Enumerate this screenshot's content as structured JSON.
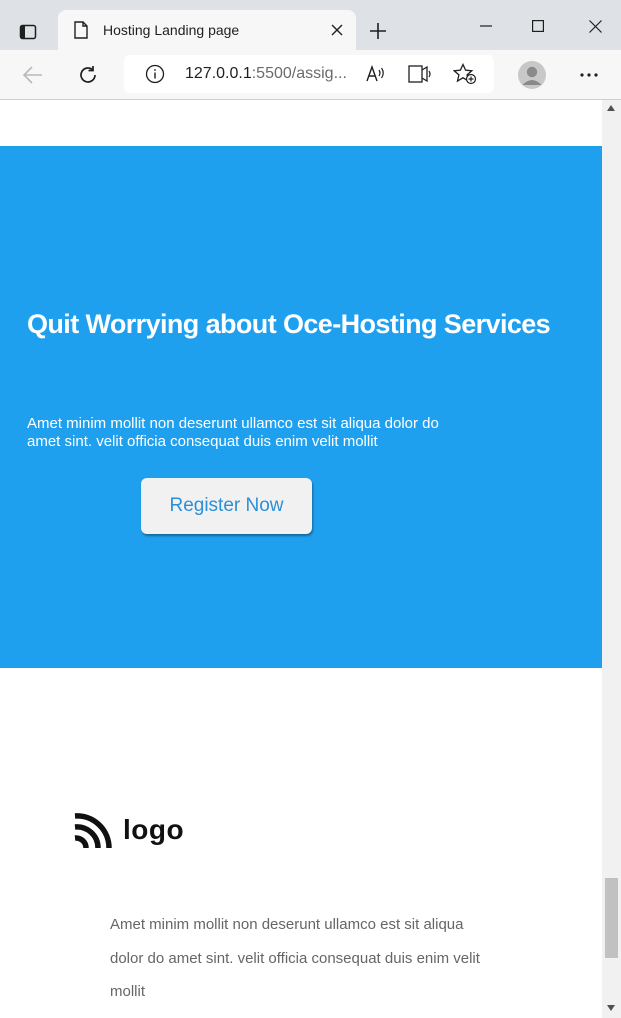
{
  "browser": {
    "tab_title": "Hosting Landing page",
    "url_host": "127.0.0.1",
    "url_rest": ":5500/assig..."
  },
  "icons": {
    "tab_actions": "tab-actions-icon",
    "page": "page-icon",
    "close": "close-icon",
    "new_tab": "plus-icon",
    "minimize": "minimize-icon",
    "maximize": "maximize-icon",
    "window_close": "close-icon",
    "back": "back-arrow-icon",
    "refresh": "refresh-icon",
    "site_info": "info-icon",
    "read_aloud": "read-aloud-icon",
    "immersive_reader": "immersive-reader-icon",
    "favorites": "favorites-star-icon",
    "profile": "profile-avatar-icon",
    "more": "more-dots-icon"
  },
  "hero": {
    "title": "Quit Worrying about Oce-Hosting Services",
    "text": "Amet minim mollit non deserunt ullamco est sit aliqua dolor do amet sint. velit officia consequat duis enim velit mollit",
    "button_label": "Register Now",
    "background_color": "#1fa0ee"
  },
  "footer": {
    "logo_text": "logo",
    "text": "Amet minim mollit non deserunt ullamco est sit aliqua dolor do amet sint. velit officia consequat duis enim velit mollit"
  }
}
